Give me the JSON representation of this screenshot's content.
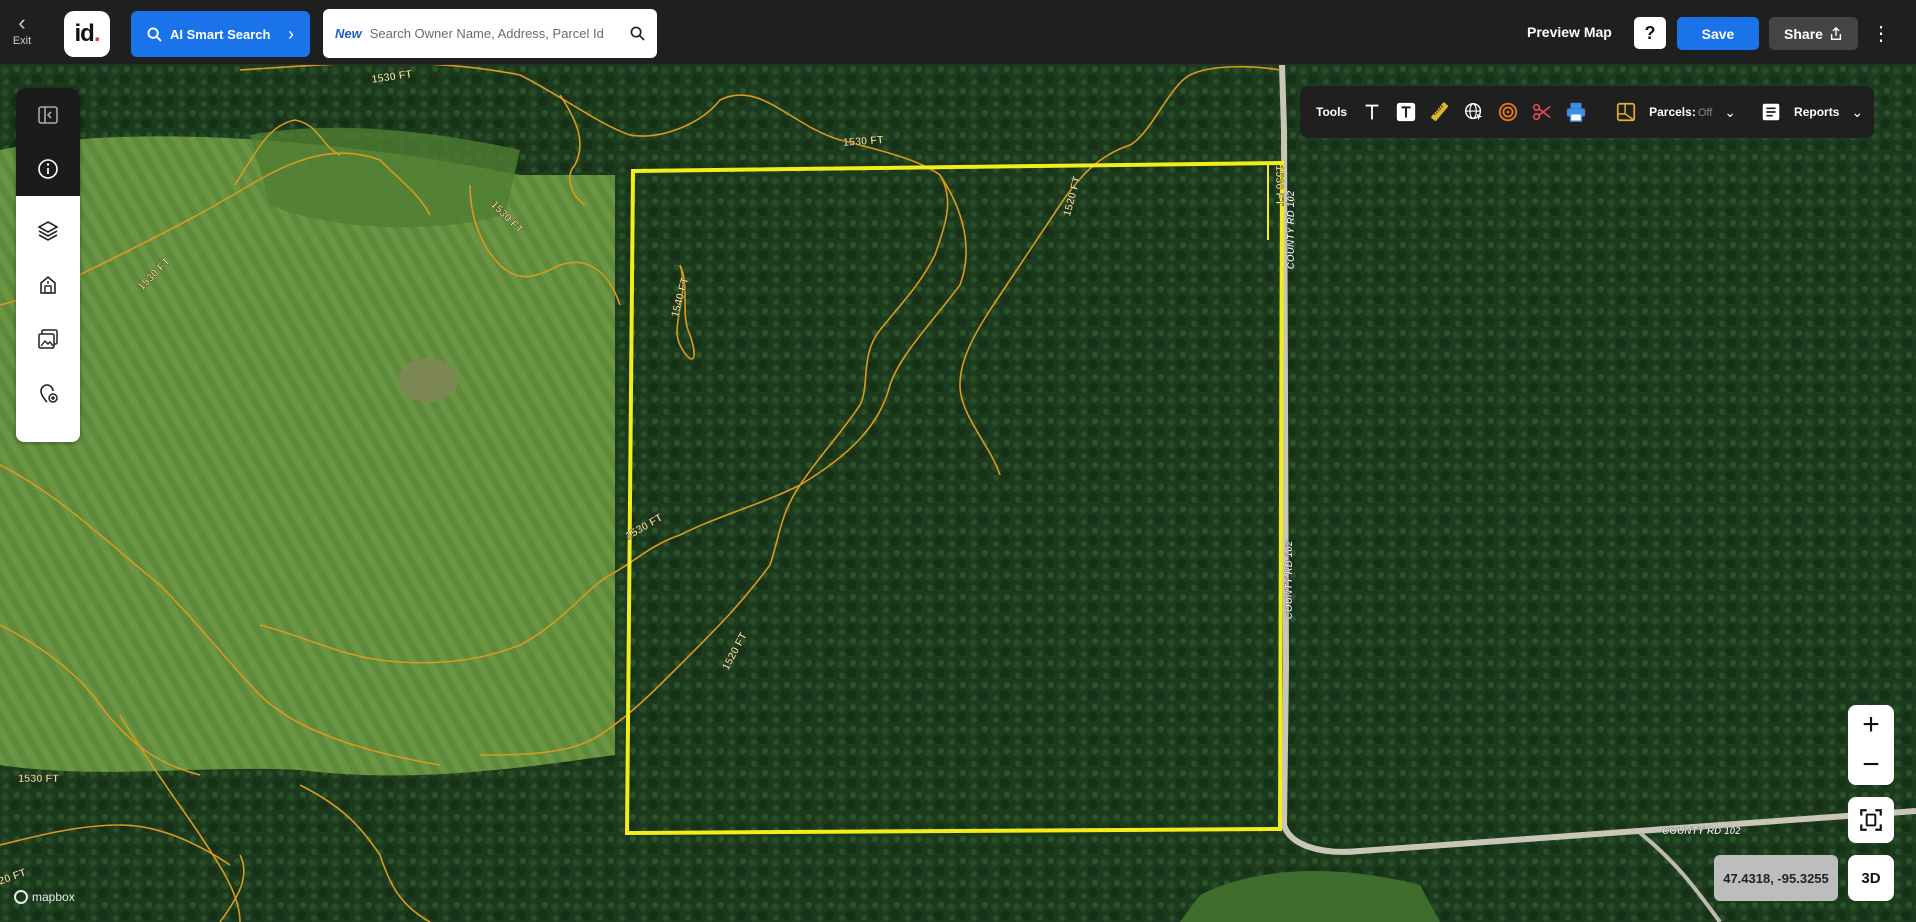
{
  "topbar": {
    "exit_label": "Exit",
    "logo_text": "id",
    "logo_dot": ".",
    "ai_search_label": "AI Smart Search",
    "search_new_tag": "New",
    "search_placeholder": "Search Owner Name, Address, Parcel Id",
    "preview_label": "Preview Map",
    "help_label": "?",
    "save_label": "Save",
    "share_label": "Share"
  },
  "tools": {
    "label": "Tools",
    "items": [
      "text-icon",
      "text-box-icon",
      "ruler-icon",
      "globe-cursor-icon",
      "radius-icon",
      "scissors-icon",
      "print-icon"
    ],
    "parcels_label": "Parcels:",
    "parcels_value": "Off",
    "reports_label": "Reports"
  },
  "left_toolbar": [
    "collapse-panel-icon",
    "info-icon",
    "layers-icon",
    "buildings-icon",
    "imagery-icon",
    "add-location-icon"
  ],
  "map": {
    "contour_labels": [
      "1530 FT",
      "1530 FT",
      "1530 FT",
      "1530 FT",
      "1540 FT",
      "1520 FT",
      "1530 FT",
      "1520 FT",
      "1530 FT",
      "20 FT",
      "1530 FT"
    ],
    "road_labels": [
      "COUNTY RD 102",
      "COUNTY RD 102",
      "COUNTY RD 102"
    ],
    "coordinates": "47.4318, -95.3255",
    "btn_3d": "3D",
    "attribution": "mapbox",
    "zoom_in": "+",
    "zoom_out": "−",
    "colors": {
      "parcel_outline": "#f2ee1c",
      "contour": "#d99a1f",
      "forest": "#1d3a1e",
      "field": "#5f8a3c",
      "road": "#c9c6b8"
    }
  }
}
